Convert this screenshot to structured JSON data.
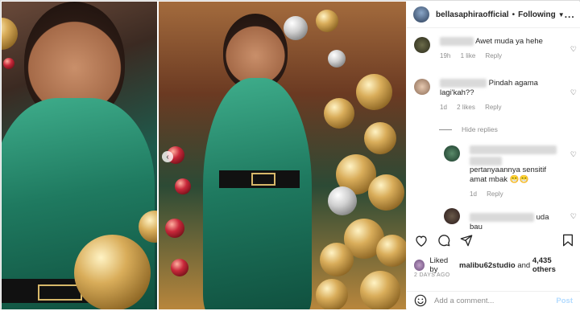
{
  "header": {
    "username": "bellasaphiraofficial",
    "separator": "•",
    "follow_label": "Following",
    "more": "..."
  },
  "comments": [
    {
      "text": "Awet muda ya hehe",
      "time": "19h",
      "likes": "1 like",
      "reply": "Reply"
    },
    {
      "text_line1": "Pindah agama",
      "text_line2": "lagi'kah??",
      "time": "1d",
      "likes": "2 likes",
      "reply": "Reply",
      "hide_replies": "Hide replies"
    },
    {
      "text_line1": "pertanyaannya sensitif",
      "text_line2": "amat mbak",
      "emoji": "😁😁",
      "time": "1d",
      "reply": "Reply"
    },
    {
      "text": "uda bau"
    }
  ],
  "likes": {
    "prefix": "Liked by",
    "user": "malibu62studio",
    "and": "and",
    "count": "4,435 others"
  },
  "date": "2 DAYS AGO",
  "composer": {
    "placeholder": "Add a comment...",
    "post_label": "Post"
  },
  "colors": {
    "dress": "#1f7a60",
    "link_disabled": "#b3dbff",
    "muted": "#8e8e8e"
  }
}
